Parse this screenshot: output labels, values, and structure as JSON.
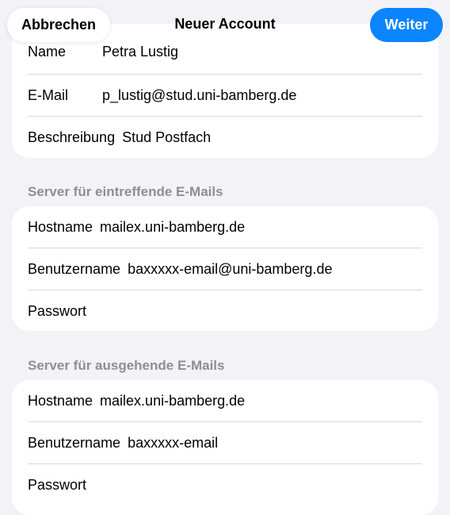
{
  "navbar": {
    "cancel_label": "Abbrechen",
    "title": "Neuer Account",
    "next_label": "Weiter",
    "accent_color": "#0a84ff"
  },
  "account": {
    "rows": [
      {
        "label": "Name",
        "value": "Petra Lustig"
      },
      {
        "label": "E-Mail",
        "value": "p_lustig@stud.uni-bamberg.de"
      },
      {
        "label": "Beschreibung",
        "value": "Stud Postfach"
      }
    ]
  },
  "incoming": {
    "header": "Server für eintreffende E-Mails",
    "rows": [
      {
        "label": "Hostname",
        "value": "mailex.uni-bamberg.de"
      },
      {
        "label": "Benutzername",
        "value": "baxxxxx-email@uni-bamberg.de"
      },
      {
        "label": "Passwort",
        "value": ""
      }
    ]
  },
  "outgoing": {
    "header": "Server für ausgehende E-Mails",
    "rows": [
      {
        "label": "Hostname",
        "value": "mailex.uni-bamberg.de"
      },
      {
        "label": "Benutzername",
        "value": "baxxxxx-email"
      },
      {
        "label": "Passwort",
        "value": ""
      }
    ]
  }
}
